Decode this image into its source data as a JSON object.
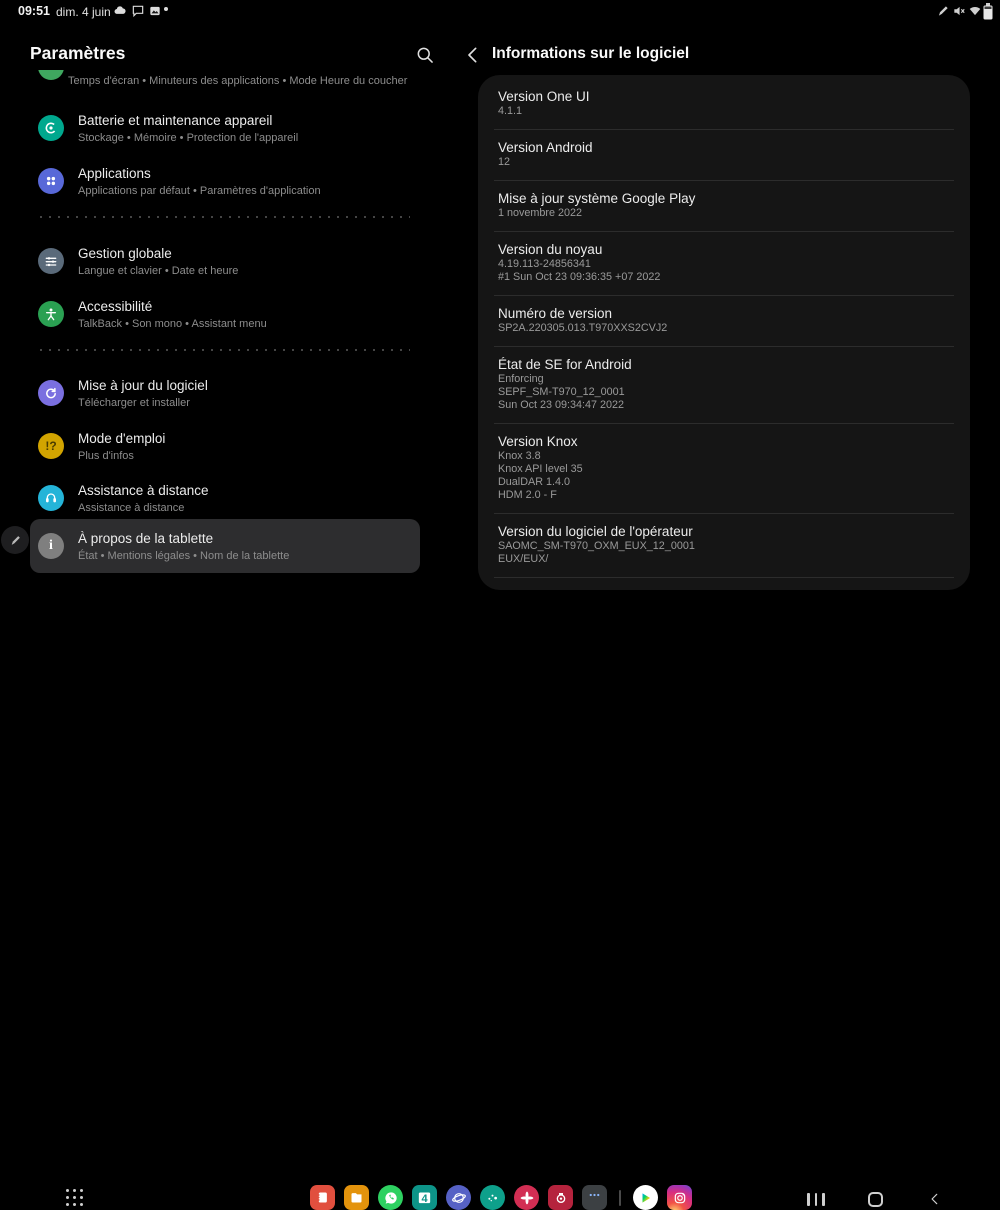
{
  "status_bar": {
    "time": "09:51",
    "date": "dim. 4 juin",
    "left_icons": [
      "cloud-icon",
      "message-icon",
      "screenshot-icon",
      "overflow-dot"
    ],
    "right_icons": [
      "stylus-icon",
      "mute-icon",
      "wifi-icon",
      "battery-icon"
    ]
  },
  "left_pane": {
    "title": "Paramètres",
    "scrolled_item_subtitle": "Temps d'écran • Minuteurs des applications • Mode Heure du coucher",
    "items": [
      {
        "title": "Batterie et maintenance appareil",
        "subtitle": "Stockage • Mémoire • Protection de l'appareil",
        "icon": "battery-maintenance-icon",
        "icon_style": "background:#00a88e"
      },
      {
        "title": "Applications",
        "subtitle": "Applications par défaut • Paramètres d'application",
        "icon": "apps-icon",
        "icon_style": "background:#5868d8"
      },
      {
        "title": "Gestion globale",
        "subtitle": "Langue et clavier • Date et heure",
        "icon": "global-management-icon",
        "icon_style": "background:#5a6a7a"
      },
      {
        "title": "Accessibilité",
        "subtitle": "TalkBack • Son mono • Assistant menu",
        "icon": "accessibility-icon",
        "icon_style": "background:#2aa052"
      },
      {
        "title": "Mise à jour du logiciel",
        "subtitle": "Télécharger et installer",
        "icon": "software-update-icon",
        "icon_style": "background:#7a6fe0"
      },
      {
        "title": "Mode d'emploi",
        "subtitle": "Plus d'infos",
        "icon": "user-manual-icon",
        "icon_style": "background:#d2a400",
        "icon_glyph": "!?"
      },
      {
        "title": "Assistance à distance",
        "subtitle": "Assistance à distance",
        "icon": "remote-support-icon",
        "icon_style": "background:#24b4d8"
      },
      {
        "title": "À propos de la tablette",
        "subtitle": "État • Mentions légales • Nom de la tablette",
        "icon": "about-icon",
        "icon_style": "background:#7f7f7f",
        "icon_glyph": "i",
        "selected": true
      }
    ]
  },
  "right_pane": {
    "title": "Informations sur le logiciel",
    "items": [
      {
        "title": "Version One UI",
        "lines": [
          "4.1.1"
        ]
      },
      {
        "title": "Version Android",
        "lines": [
          "12"
        ]
      },
      {
        "title": "Mise à jour système Google Play",
        "lines": [
          "1 novembre 2022"
        ]
      },
      {
        "title": "Version du noyau",
        "lines": [
          "4.19.113-24856341",
          "#1 Sun Oct 23 09:36:35 +07 2022"
        ]
      },
      {
        "title": "Numéro de version",
        "lines": [
          "SP2A.220305.013.T970XXS2CVJ2"
        ]
      },
      {
        "title": "État de SE for Android",
        "lines": [
          "Enforcing",
          "SEPF_SM-T970_12_0001",
          "Sun Oct 23 09:34:47 2022"
        ]
      },
      {
        "title": "Version Knox",
        "lines": [
          "Knox 3.8",
          "Knox API level 35",
          "DualDAR 1.4.0",
          "HDM 2.0 - F"
        ]
      },
      {
        "title": "Version du logiciel de l'opérateur",
        "lines": [
          "SAOMC_SM-T970_OXM_EUX_12_0001",
          "EUX/EUX/"
        ]
      }
    ]
  },
  "taskbar": {
    "apps_button": "app-grid-icon",
    "app_icons": [
      "notes-icon",
      "my-files-icon",
      "whatsapp-icon",
      "calendar-icon",
      "internet-icon",
      "members-icon",
      "gallery-icon",
      "camera-icon",
      "recent-group-icon",
      "play-store-icon",
      "instagram-icon"
    ],
    "calendar_day": "4",
    "nav": [
      "recents-button",
      "home-button",
      "back-button"
    ]
  },
  "edge_handle": "pen-handle-icon",
  "colors": {
    "background": "#000000",
    "card": "#151515",
    "selected_item": "#2d2d2f",
    "title_text": "#ececec",
    "subtitle_text": "#8d8d8d"
  }
}
